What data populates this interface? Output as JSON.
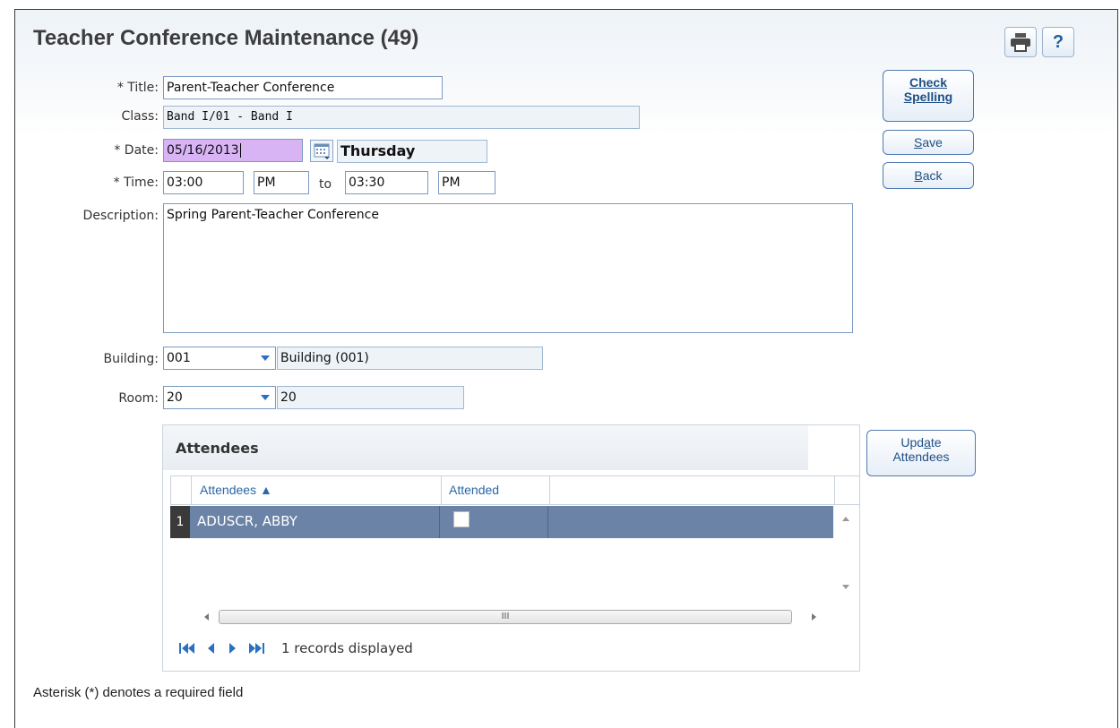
{
  "title": "Teacher Conference Maintenance (49)",
  "toolbar": {
    "print_icon": "printer-icon",
    "help_label": "?"
  },
  "form": {
    "title_label": "* Title:",
    "title_value": "Parent-Teacher Conference",
    "class_label": "Class:",
    "class_value": "Band I/01 - Band I",
    "date_label": "* Date:",
    "date_value": "05/16/2013",
    "day_value": "Thursday",
    "time_label": "* Time:",
    "start_time": "03:00",
    "start_ampm": "PM",
    "to_label": "to",
    "end_time": "03:30",
    "end_ampm": "PM",
    "description_label": "Description:",
    "description_value": "Spring Parent-Teacher Conference",
    "building_label": "Building:",
    "building_code": "001",
    "building_name": "Building (001)",
    "room_label": "Room:",
    "room_code": "20",
    "room_name": "20"
  },
  "buttons": {
    "check_spelling_line1": "Check",
    "check_spelling_line2": "Spelling",
    "save_prefix": "S",
    "save_rest": "ave",
    "back_prefix": "B",
    "back_rest": "ack",
    "update_line1_a": "Upd",
    "update_line1_u": "a",
    "update_line1_b": "te",
    "update_line2": "Attendees"
  },
  "attendees": {
    "panel_title": "Attendees",
    "columns": [
      "Attendees ▲",
      "Attended"
    ],
    "rows": [
      {
        "num": "1",
        "name": "ADUSCR, ABBY",
        "attended": false
      }
    ],
    "records_text": "1 records displayed",
    "hscroll_grip": "III"
  },
  "footnote": "Asterisk (*) denotes a required field",
  "colors": {
    "accent": "#2a6fc0",
    "selected_row": "#6a83a6",
    "date_highlight": "#d8b4f5"
  }
}
